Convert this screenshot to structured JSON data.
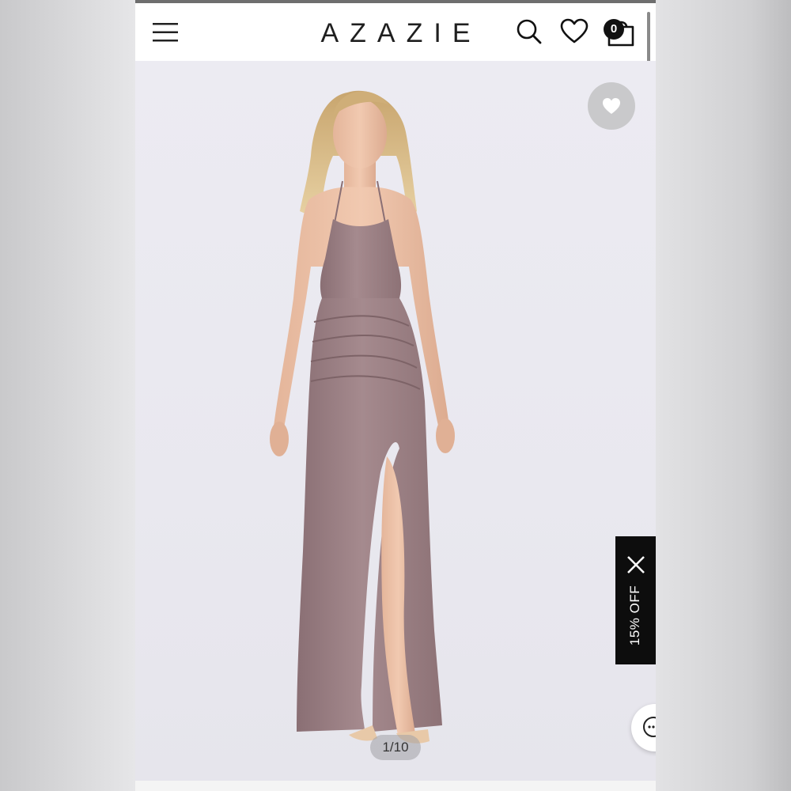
{
  "header": {
    "brand": "AZAZIE",
    "cart_count": "0"
  },
  "gallery": {
    "counter": "1/10",
    "image_description": "Model wearing a long mauve spaghetti-strap gown with a ruched wrap skirt and high front slit"
  },
  "promo": {
    "label": "15% OFF"
  },
  "colors": {
    "dress": "#9b7f83",
    "background": "#ecebf2",
    "promo_bg": "#0d0d0d",
    "wishlist_button": "#c9c9cb"
  },
  "icons": {
    "menu": "hamburger-menu-icon",
    "search": "search-icon",
    "wishlist": "heart-icon",
    "cart": "shopping-bag-icon",
    "close": "close-icon",
    "chat": "chat-icon"
  }
}
